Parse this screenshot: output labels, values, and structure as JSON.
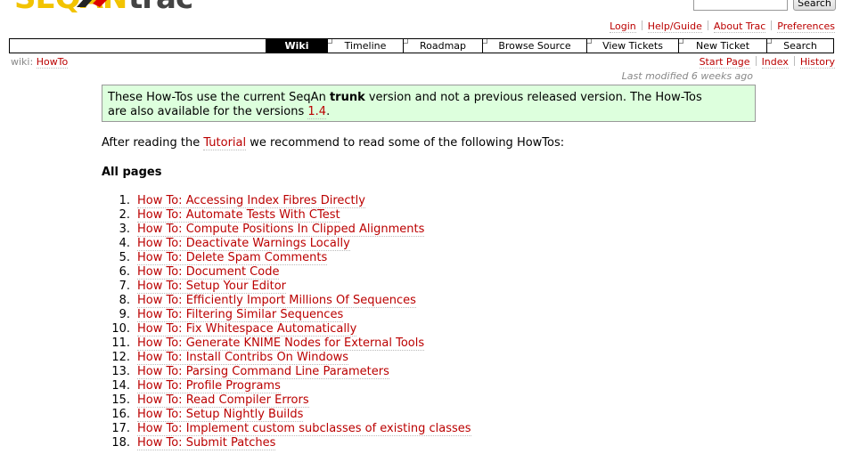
{
  "header": {
    "logo_text_left": "SEQAN",
    "logo_text_right": "trac",
    "search_button": "Search"
  },
  "metanav": [
    "Login",
    "Help/Guide",
    "About Trac",
    "Preferences"
  ],
  "mainnav": [
    {
      "label": "Wiki",
      "active": true,
      "w": 68
    },
    {
      "label": "Timeline",
      "active": false,
      "w": 84
    },
    {
      "label": "Roadmap",
      "active": false,
      "w": 88
    },
    {
      "label": "Browse Source",
      "active": false,
      "w": 116
    },
    {
      "label": "View Tickets",
      "active": false,
      "w": 102
    },
    {
      "label": "New Ticket",
      "active": false,
      "w": 98
    },
    {
      "label": "Search",
      "active": false,
      "w": 74
    }
  ],
  "breadcrumb": {
    "prefix": "wiki:",
    "page": "HowTo"
  },
  "ctxnav": [
    "Start Page",
    "Index",
    "History"
  ],
  "last_modified": "Last modified 6 weeks ago",
  "notice": {
    "part1": "These How-Tos use the current SeqAn ",
    "bold": "trunk",
    "part2": " version and not a previous released version. The How-Tos",
    "part3": "are also available for the versions ",
    "link": "1.4",
    "part4": "."
  },
  "intro": {
    "before": "After reading the ",
    "link": "Tutorial",
    "after": " we recommend to read some of the following HowTos:"
  },
  "section_heading": "All pages",
  "howtos": [
    "How To: Accessing Index Fibres Directly",
    "How To: Automate Tests With CTest",
    "How To: Compute Positions In Clipped Alignments",
    "How To: Deactivate Warnings Locally",
    "How To: Delete Spam Comments",
    "How To: Document Code",
    "How To: Setup Your Editor",
    "How To: Efficiently Import Millions Of Sequences",
    "How To: Filtering Similar Sequences",
    "How To: Fix Whitespace Automatically",
    "How To: Generate KNIME Nodes for External Tools",
    "How To: Install Contribs On Windows",
    "How To: Parsing Command Line Parameters",
    "How To: Profile Programs",
    "How To: Read Compiler Errors",
    "How To: Setup Nightly Builds",
    "How To: Implement custom subclasses of existing classes",
    "How To: Submit Patches"
  ]
}
